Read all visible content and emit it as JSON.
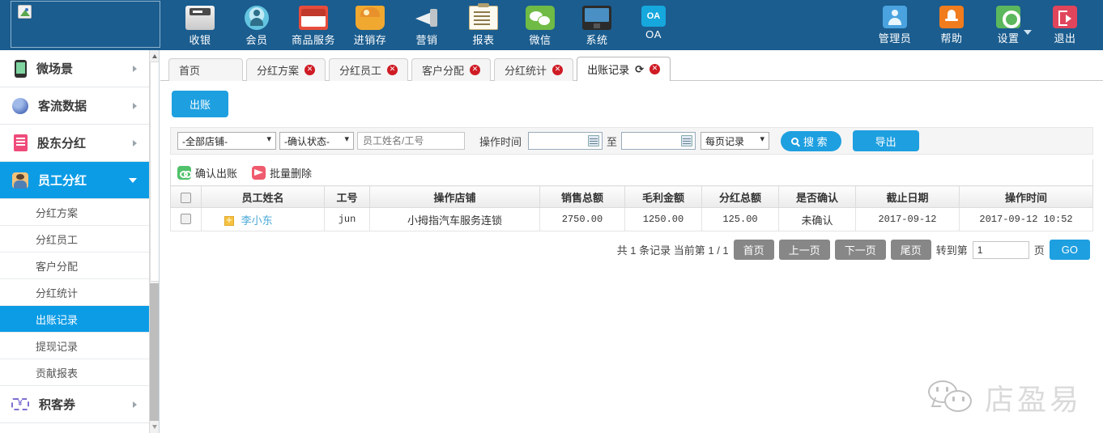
{
  "topbar": {
    "logo_alt": "broken-image",
    "nav": [
      {
        "label": "收银",
        "icon": "cash-register-icon"
      },
      {
        "label": "会员",
        "icon": "member-icon"
      },
      {
        "label": "商品服务",
        "icon": "goods-service-icon"
      },
      {
        "label": "进销存",
        "icon": "inventory-icon"
      },
      {
        "label": "营销",
        "icon": "megaphone-icon"
      },
      {
        "label": "报表",
        "icon": "report-icon"
      },
      {
        "label": "微信",
        "icon": "wechat-icon"
      },
      {
        "label": "系统",
        "icon": "monitor-icon"
      },
      {
        "label": "OA",
        "icon": "oa-icon",
        "badge": "OA"
      }
    ],
    "right": [
      {
        "label": "管理员",
        "icon": "admin-user-icon"
      },
      {
        "label": "帮助",
        "icon": "help-bell-icon"
      },
      {
        "label": "设置",
        "icon": "gear-icon",
        "has_caret": true
      },
      {
        "label": "退出",
        "icon": "logout-icon"
      }
    ],
    "bg_color": "#1b5d8f"
  },
  "sidebar": {
    "items": [
      {
        "label": "微场景",
        "icon": "phone-icon",
        "type": "group",
        "active": false
      },
      {
        "label": "客流数据",
        "icon": "globe-icon",
        "type": "group",
        "active": false
      },
      {
        "label": "股东分红",
        "icon": "doc-icon",
        "type": "group",
        "active": false
      },
      {
        "label": "员工分红",
        "icon": "people-icon",
        "type": "group",
        "active": true
      }
    ],
    "sub_items": [
      {
        "label": "分红方案",
        "active": false
      },
      {
        "label": "分红员工",
        "active": false
      },
      {
        "label": "客户分配",
        "active": false
      },
      {
        "label": "分红统计",
        "active": false
      },
      {
        "label": "出账记录",
        "active": true
      },
      {
        "label": "提现记录",
        "active": false
      },
      {
        "label": "贡献报表",
        "active": false
      }
    ],
    "footer_item": {
      "label": "积客券",
      "icon": "coupon-icon"
    },
    "active_color": "#0c9ce6"
  },
  "tabs": [
    {
      "label": "首页",
      "closable": false,
      "active": false
    },
    {
      "label": "分红方案",
      "closable": true,
      "active": false
    },
    {
      "label": "分红员工",
      "closable": true,
      "active": false
    },
    {
      "label": "客户分配",
      "closable": true,
      "active": false
    },
    {
      "label": "分红统计",
      "closable": true,
      "active": false
    },
    {
      "label": "出账记录",
      "closable": true,
      "active": true,
      "refresh": "⟳"
    }
  ],
  "toolbar": {
    "chuzhang_label": "出账"
  },
  "filters": {
    "shop_select": "-全部店铺-",
    "status_select": "-确认状态-",
    "name_placeholder": "员工姓名/工号",
    "name_value": "",
    "time_label": "操作时间",
    "date_from": "",
    "date_to": "",
    "between_label": "至",
    "page_size_select": "每页记录",
    "search_label": "搜 索",
    "export_label": "导出"
  },
  "actions": [
    {
      "label": "确认出账",
      "icon": "confirm-link-icon",
      "color": "#51c16b"
    },
    {
      "label": "批量删除",
      "icon": "batch-delete-icon",
      "color": "#ef5b6e"
    }
  ],
  "table": {
    "columns": [
      "员工姓名",
      "工号",
      "操作店铺",
      "销售总额",
      "毛利金额",
      "分红总额",
      "是否确认",
      "截止日期",
      "操作时间"
    ],
    "rows": [
      {
        "name": "李小东",
        "emp_no": "jun",
        "shop": "小拇指汽车服务连锁",
        "sales_total": "2750.00",
        "gross_profit": "1250.00",
        "dividend_total": "125.00",
        "confirmed": "未确认",
        "deadline": "2017-09-12",
        "op_time": "2017-09-12 10:52"
      }
    ]
  },
  "pagination": {
    "summary": "共 1 条记录 当前第 1 / 1",
    "first": "首页",
    "prev": "上一页",
    "next": "下一页",
    "last": "尾页",
    "goto_label": "转到第",
    "page_value": "1",
    "page_unit": "页",
    "go": "GO"
  },
  "watermark": {
    "text": "店盈易",
    "icon": "wechat-bubbles-icon"
  }
}
